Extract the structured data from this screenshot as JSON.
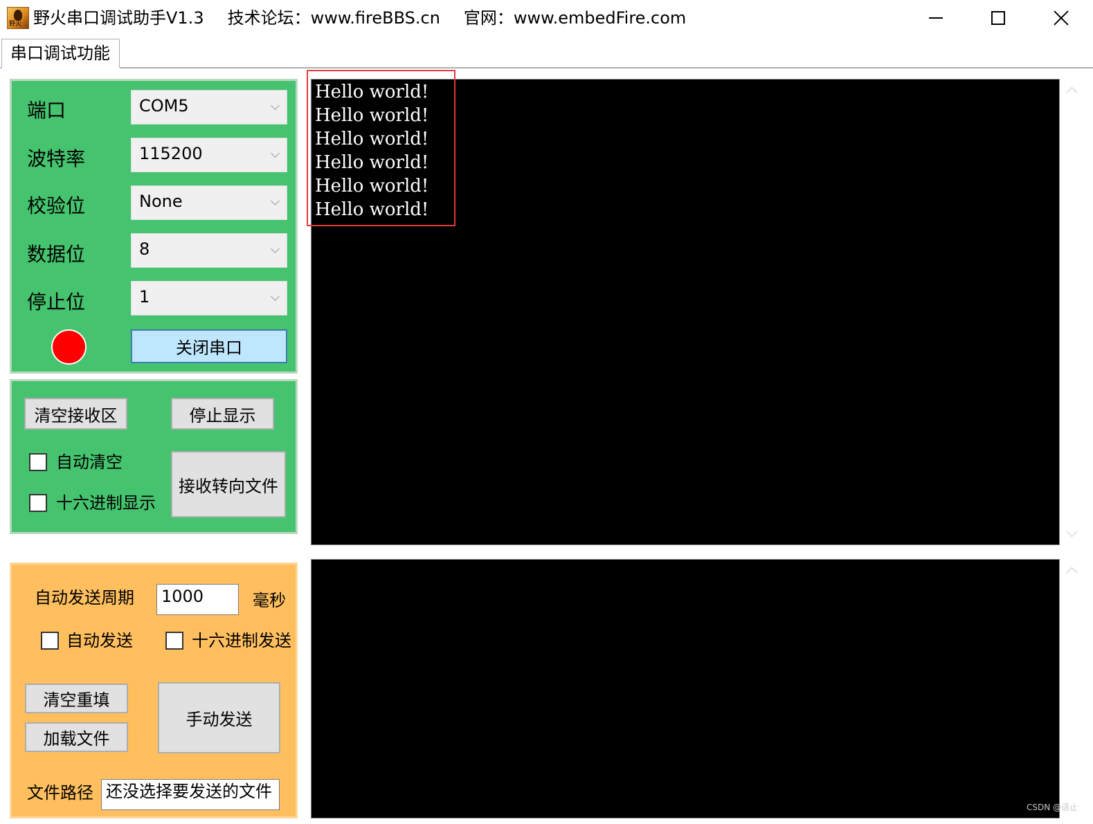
{
  "window": {
    "app_title": "野火串口调试助手V1.3",
    "forum": "技术论坛：www.fireBBS.cn",
    "website": "官网：www.embedFire.com",
    "icon_text": "野火"
  },
  "tab": {
    "label": "串口调试功能"
  },
  "port_settings": {
    "port_label": "端口",
    "port_value": "COM5",
    "baud_label": "波特率",
    "baud_value": "115200",
    "parity_label": "校验位",
    "parity_value": "None",
    "databits_label": "数据位",
    "databits_value": "8",
    "stopbits_label": "停止位",
    "stopbits_value": "1",
    "status_color": "#ff0000",
    "toggle_button": "关闭串口"
  },
  "receive": {
    "clear_button": "清空接收区",
    "stop_display_button": "停止显示",
    "auto_clear_label": "自动清空",
    "auto_clear_checked": false,
    "hex_display_label": "十六进制显示",
    "hex_display_checked": false,
    "redirect_button": "接收转向文件",
    "lines": [
      "Hello world!",
      "Hello world!",
      "Hello world!",
      "Hello world!",
      "Hello world!",
      "Hello world!"
    ]
  },
  "send": {
    "period_label": "自动发送周期",
    "period_value": "1000",
    "period_unit": "毫秒",
    "auto_send_label": "自动发送",
    "auto_send_checked": false,
    "hex_send_label": "十六进制发送",
    "hex_send_checked": false,
    "clear_refill_button": "清空重填",
    "load_file_button": "加载文件",
    "manual_send_button": "手动发送",
    "file_path_label": "文件路径",
    "file_path_value": "还没选择要发送的文件"
  },
  "colors": {
    "panel_green": "#45c36e",
    "panel_orange": "#ffbf5f",
    "terminal_bg": "#000000",
    "highlight_box": "#e53935"
  },
  "watermark": "CSDN @语止"
}
